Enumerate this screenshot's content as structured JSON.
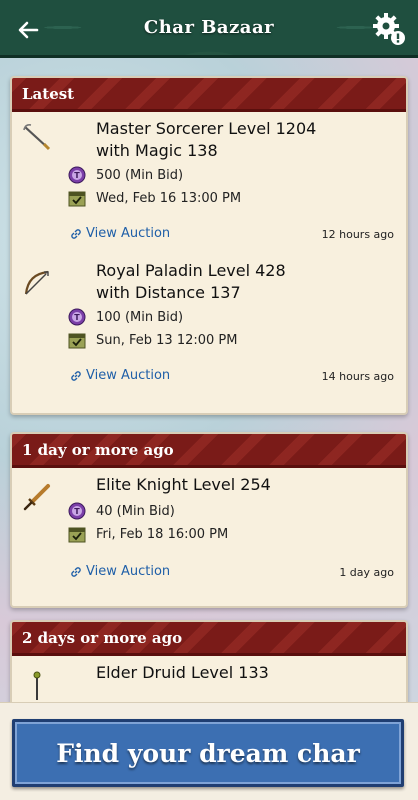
{
  "header": {
    "title": "Char Bazaar"
  },
  "sections": [
    {
      "title": "Latest",
      "entries": [
        {
          "title_line1": "Master Sorcerer Level 1204",
          "title_line2": "with Magic 138",
          "bid": "500 (Min Bid)",
          "date": "Wed, Feb 16 13:00 PM",
          "link": "View Auction",
          "ago": "12 hours ago",
          "icon": "wand-icon"
        },
        {
          "title_line1": "Royal Paladin Level 428",
          "title_line2": "with Distance 137",
          "bid": "100 (Min Bid)",
          "date": "Sun, Feb 13 12:00 PM",
          "link": "View Auction",
          "ago": "14 hours ago",
          "icon": "bow-icon"
        }
      ]
    },
    {
      "title": "1 day or more ago",
      "entries": [
        {
          "title_line1": "Elite Knight Level 254",
          "bid": "40 (Min Bid)",
          "date": "Fri, Feb 18 16:00 PM",
          "link": "View Auction",
          "ago": "1 day ago",
          "icon": "sword-icon"
        }
      ]
    },
    {
      "title": "2 days or more ago",
      "entries": [
        {
          "title_line1": "Elder Druid Level 133",
          "icon": "rod-icon"
        }
      ]
    }
  ],
  "cta": {
    "label": "Find your dream char"
  },
  "colors": {
    "header_bg": "#1f4f3f",
    "section_header": "#7a1b18",
    "link": "#1f5fa8",
    "cta_bg": "#3c6fb2",
    "coin": "#7b3fa8"
  }
}
